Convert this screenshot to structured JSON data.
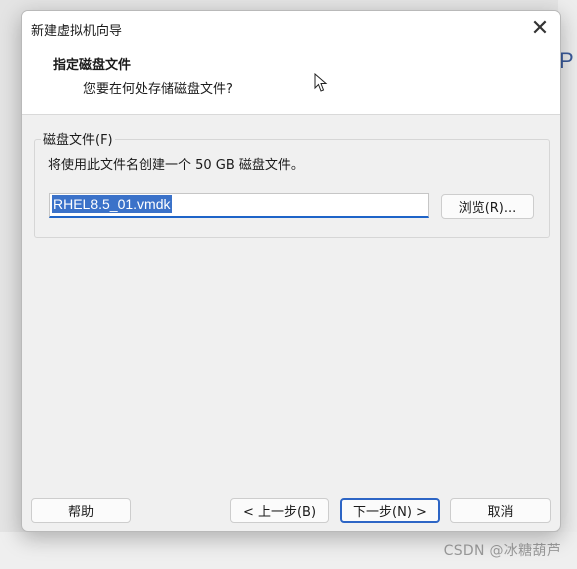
{
  "dialog": {
    "title": "新建虚拟机向导",
    "close_glyph": "✕",
    "header": {
      "title": "指定磁盘文件",
      "subtitle": "您要在何处存储磁盘文件?"
    },
    "disk_group": {
      "legend": "磁盘文件(F)",
      "description": "将使用此文件名创建一个 50 GB 磁盘文件。",
      "file_value": "RHEL8.5_01.vmdk",
      "browse_label": "浏览(R)..."
    },
    "buttons": {
      "help": "帮助",
      "back": "< 上一步(B)",
      "next": "下一步(N) >",
      "cancel": "取消"
    }
  },
  "backdrop": {
    "partial_glyph": "P"
  },
  "watermark": "CSDN @冰糖葫芦",
  "icons": {
    "close": "close-icon",
    "cursor": "mouse-cursor-icon"
  },
  "colors": {
    "accent": "#2d65c5",
    "selection": "#3b72c9",
    "dialog_bg": "#f0f0f0"
  }
}
